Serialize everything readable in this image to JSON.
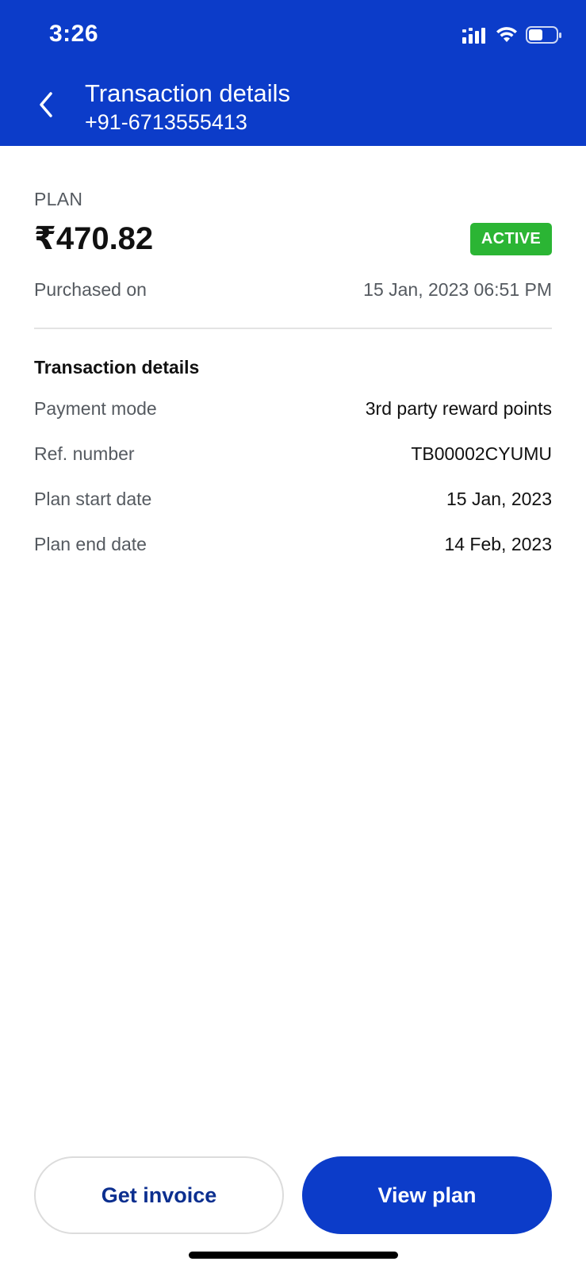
{
  "status_bar": {
    "time": "3:26",
    "icons": [
      "signal-icon",
      "wifi-icon",
      "battery-icon"
    ]
  },
  "header": {
    "title": "Transaction details",
    "subtitle": "+91-6713555413",
    "back_icon": "chevron-left-icon"
  },
  "plan": {
    "label": "PLAN",
    "amount": "₹470.82",
    "status": "ACTIVE",
    "purchased_label": "Purchased on",
    "purchased_value": "15 Jan, 2023 06:51 PM"
  },
  "transaction": {
    "title": "Transaction details",
    "rows": [
      {
        "label": "Payment mode",
        "value": "3rd party reward points"
      },
      {
        "label": "Ref. number",
        "value": "TB00002CYUMU"
      },
      {
        "label": "Plan start date",
        "value": "15 Jan, 2023"
      },
      {
        "label": "Plan end date",
        "value": "14 Feb, 2023"
      }
    ]
  },
  "actions": {
    "invoice_label": "Get invoice",
    "view_label": "View plan"
  },
  "colors": {
    "brand": "#0c3cc9",
    "active": "#2bb534"
  }
}
